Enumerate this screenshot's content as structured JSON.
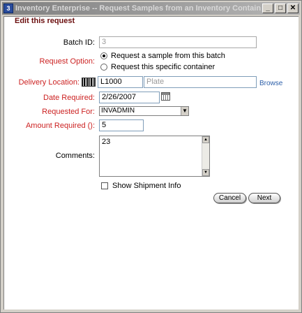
{
  "window": {
    "title": "Inventory Enterprise -- Request Samples from an Inventory Container -- Micros...",
    "icon": "inventory-app-icon",
    "controls": {
      "minimize": "_",
      "maximize": "□",
      "close": "✕"
    }
  },
  "form": {
    "heading": "Edit this request",
    "batch_id": {
      "label": "Batch ID:",
      "value": "3"
    },
    "request_option": {
      "label": "Request Option:",
      "options": [
        {
          "label": "Request a sample from this batch",
          "selected": true
        },
        {
          "label": "Request this specific container",
          "selected": false
        }
      ]
    },
    "delivery_location": {
      "label": "Delivery Location:",
      "value": "L1000",
      "plate_placeholder": "Plate",
      "browse_label": "Browse"
    },
    "date_required": {
      "label": "Date Required:",
      "value": "2/26/2007"
    },
    "requested_for": {
      "label": "Requested For:",
      "value": "INVADMIN"
    },
    "amount_required": {
      "label": "Amount Required ():",
      "value": "5"
    },
    "comments": {
      "label": "Comments:",
      "value": "23"
    },
    "show_shipment": {
      "label": "Show Shipment Info",
      "checked": false
    },
    "buttons": {
      "cancel": "Cancel",
      "next": "Next"
    }
  },
  "colors": {
    "required_label": "#cc2222",
    "heading": "#6b0f0f",
    "link": "#2b5ea8",
    "window_bg": "#d4d0c8"
  }
}
